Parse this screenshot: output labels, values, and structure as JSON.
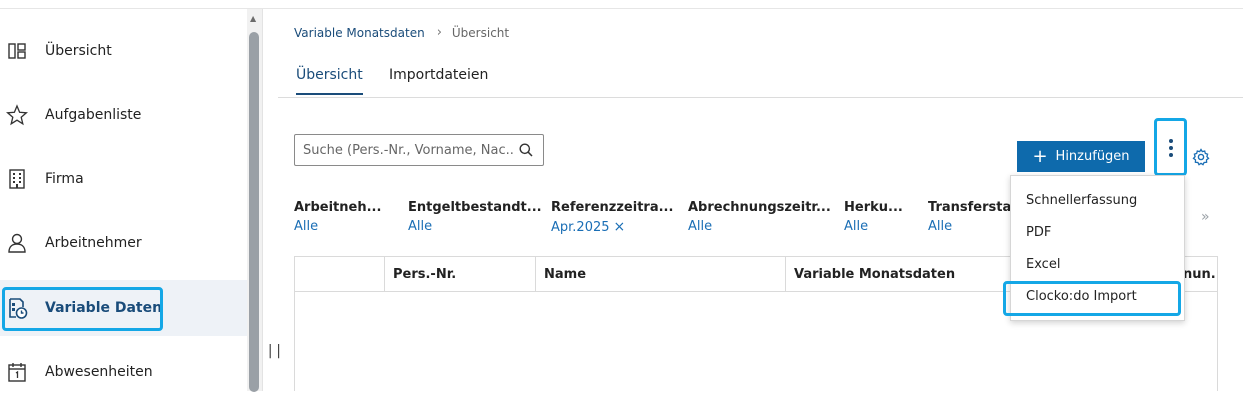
{
  "sidebar": {
    "items": [
      {
        "label": "Übersicht",
        "icon": "layout-icon"
      },
      {
        "label": "Aufgabenliste",
        "icon": "star-icon"
      },
      {
        "label": "Firma",
        "icon": "building-icon"
      },
      {
        "label": "Arbeitnehmer",
        "icon": "person-icon"
      },
      {
        "label": "Variable Daten",
        "icon": "variable-data-icon"
      },
      {
        "label": "Abwesenheiten",
        "icon": "calendar-icon"
      }
    ]
  },
  "breadcrumb": {
    "link": "Variable Monatsdaten",
    "separator": "›",
    "current": "Übersicht"
  },
  "tabs": [
    {
      "label": "Übersicht"
    },
    {
      "label": "Importdateien"
    }
  ],
  "search": {
    "placeholder": "Suche (Pers.-Nr., Vorname, Nac..."
  },
  "toolbar": {
    "add_label": "Hinzufügen",
    "add_plus": "+"
  },
  "filters": [
    {
      "title": "Arbeitneh...",
      "value": "Alle"
    },
    {
      "title": "Entgeltbestandt...",
      "value": "Alle"
    },
    {
      "title": "Referenzzeitra...",
      "value": "Apr.2025",
      "clear": "×"
    },
    {
      "title": "Abrechnungszeitr...",
      "value": "Alle"
    },
    {
      "title": "Herku...",
      "value": "Alle"
    },
    {
      "title": "Transferstat...",
      "value": "Alle"
    }
  ],
  "more_filters": "»",
  "table": {
    "columns": [
      "",
      "Pers.-Nr.",
      "Name",
      "Variable Monatsdaten",
      "nun.."
    ]
  },
  "menu": {
    "items": [
      "Schnellerfassung",
      "PDF",
      "Excel",
      "Clocko:do Import"
    ]
  },
  "resize_handle": "||",
  "colors": {
    "accent": "#0e6aac",
    "highlight": "#14a7e6",
    "link": "#1a4c7a"
  }
}
